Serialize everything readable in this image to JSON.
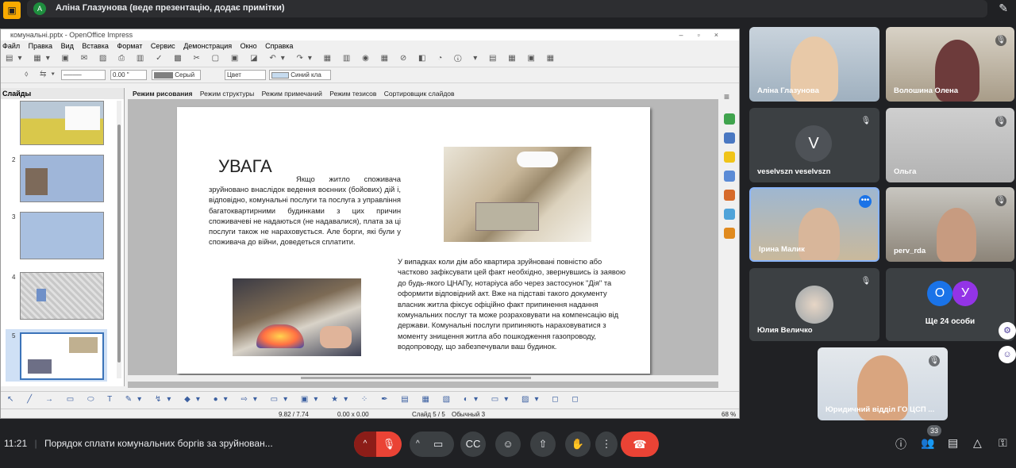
{
  "meet": {
    "presenter_initial": "А",
    "presenter_text": "Аліна Глазунова (веде презентацію, додає примітки)",
    "time": "11:21",
    "meeting_title": "Порядок сплати комунальних боргів за зруйнован...",
    "participants_count": "33",
    "more_people": "Ще 24 особи"
  },
  "impress": {
    "title": "комунальні.pptx - OpenOffice Impress",
    "menu": [
      "Файл",
      "Правка",
      "Вид",
      "Вставка",
      "Формат",
      "Сервис",
      "Демонстрация",
      "Окно",
      "Справка"
    ],
    "toolbar2": {
      "line_width": "0.00 \"",
      "line_color": "Серый",
      "area_type": "Цвет",
      "area_color": "Синий кла"
    },
    "slides_title": "Слайды",
    "slide_numbers": [
      "2",
      "3",
      "4",
      "5"
    ],
    "view_tabs": [
      "Режим рисования",
      "Режим структуры",
      "Режим примечаний",
      "Режим тезисов",
      "Сортировщик слайдов"
    ],
    "status": {
      "position": "9.82 / 7.74",
      "size": "0.00 x 0.00",
      "slide": "Слайд 5 / 5",
      "layout": "Обычный 3",
      "zoom": "68 %"
    }
  },
  "slide": {
    "heading": "УВАГА",
    "paragraph1": "Якщо житло споживача зруйновано внаслідок ведення воєнних (бойових) дій і, відповідно, комунальні послуги та послуга з управління багатоквартирними будинками з цих причин споживачеві не надаються (не надавалися), плата за ці послуги також не нараховується. Але борги, які були у споживача до війни, доведеться сплатити.",
    "paragraph2": "У випадках коли дім або квартира зруйновані повністю або частково зафіксувати цей факт необхідно, звернувшись із заявою до будь-якого ЦНАПу, нотаріуса або через застосунок \"Дія\" та оформити відповідний акт. Вже на підставі такого документу власник житла фіксує офіційно факт припинення надання комунальних послуг та може розраховувати на компенсацію від держави.  Комунальні послуги припиняють нараховуватися з моменту знищення житла або пошкодження газопроводу, водопроводу, що забезпечували ваш будинок."
  },
  "participants": [
    {
      "name": "Аліна Глазунова"
    },
    {
      "name": "Волошина Олена"
    },
    {
      "name": "veselvszn veselvszn",
      "initial": "V"
    },
    {
      "name": "Ольга"
    },
    {
      "name": "Ірина Малик"
    },
    {
      "name": "perv_rda"
    },
    {
      "name": "Юлия Величко"
    },
    {
      "name": "Юридичний відділ ГО ЦСП ..."
    }
  ],
  "more_initials": [
    "О",
    "У"
  ],
  "colors": {
    "end_call": "#ea4335",
    "active_speaker": "#8ab4f8",
    "avatar_o": "#1a73e8",
    "avatar_u": "#9334e6"
  }
}
